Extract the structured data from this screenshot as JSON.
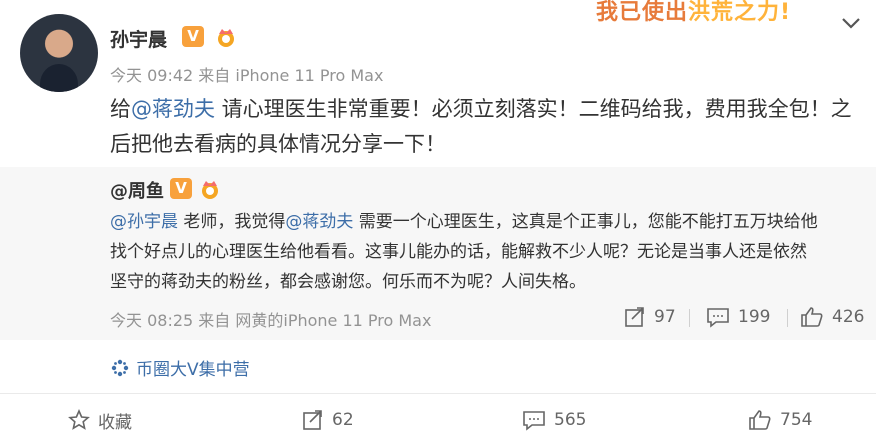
{
  "banner": {
    "text_a": "我已使出",
    "text_b": "洪荒之力!"
  },
  "post": {
    "username": "孙宇晨",
    "meta": "今天 09:42 来自 iPhone 11 Pro Max",
    "text_prefix": "给",
    "mention": "@蒋劲夫",
    "text_line1": " 请心理医生非常重要！必须立刻落实！二维码给我，费用我全包！之",
    "text_line2": "后把他去看病的具体情况分享一下！"
  },
  "repost": {
    "username": "@周鱼",
    "mention1": "@孙宇晨",
    "text_a": " 老师，我觉得",
    "mention2": "@蒋劲夫",
    "text_b": " 需要一个心理医生，这真是个正事儿，您能不能打五万块给他",
    "line2": "找个好点儿的心理医生给他看看。这事儿能办的话，能解救不少人呢？无论是当事人还是依然",
    "line3": "坚守的蒋劲夫的粉丝，都会感谢您。何乐而不为呢？人间失格。",
    "meta": "今天 08:25 来自 网黄的iPhone 11 Pro Max",
    "reposts": "97",
    "comments": "199",
    "likes": "426"
  },
  "source": {
    "label": "币圈大V集中营"
  },
  "actions": {
    "favorite": "收藏",
    "reposts": "62",
    "comments": "565",
    "likes": "754"
  },
  "icons": [
    "v-badge-icon",
    "crown-icon",
    "chevron-down-icon",
    "repost-icon",
    "comment-icon",
    "like-icon",
    "star-icon",
    "sparkle-icon"
  ],
  "colors": {
    "link": "#3d6ea8",
    "badge": "#f8a13c",
    "meta": "#939393",
    "repost_bg": "#f7f7f7"
  }
}
